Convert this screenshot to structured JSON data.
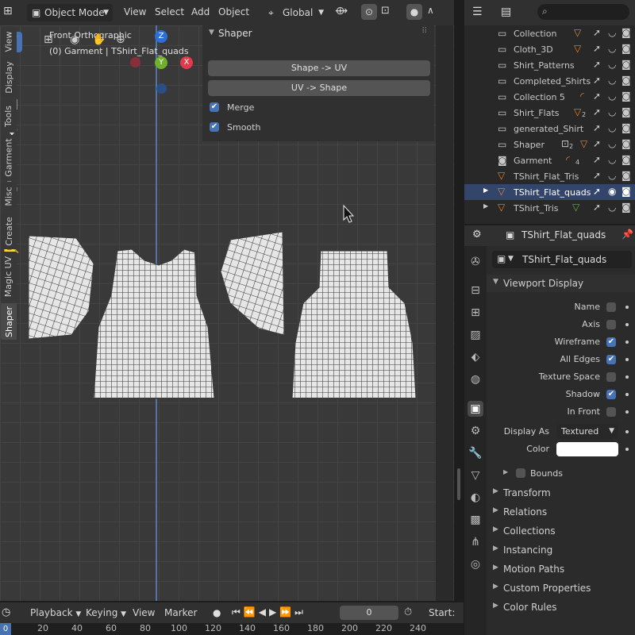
{
  "viewport_header": {
    "mode": "Object Mode",
    "menus": [
      "View",
      "Select",
      "Add",
      "Object"
    ],
    "orientation": "Global"
  },
  "viewport": {
    "view_name": "Front Orthographic",
    "object_info": "(0) Garment | TShirt_Flat_quads",
    "gizmo": {
      "z": "Z",
      "y": "Y",
      "x": "X"
    }
  },
  "npanel": {
    "title": "Shaper",
    "buttons": [
      "Shape -> UV",
      "UV -> Shape"
    ],
    "checks": [
      {
        "label": "Merge",
        "checked": true
      },
      {
        "label": "Smooth",
        "checked": true
      }
    ],
    "tabs": [
      "View",
      "Display",
      "Tools",
      "Garment",
      "Misc",
      "Create",
      "Magic UV",
      "Shaper"
    ],
    "active_tab": "Shaper"
  },
  "outliner": {
    "items": [
      {
        "name": "Collection",
        "badge": ""
      },
      {
        "name": "Cloth_3D",
        "badge": ""
      },
      {
        "name": "Shirt_Patterns",
        "badge": ""
      },
      {
        "name": "Completed_Shirts",
        "badge": ""
      },
      {
        "name": "Collection 5",
        "badge": ""
      },
      {
        "name": "Shirt_Flats",
        "badge": "2"
      },
      {
        "name": "generated_Shirt",
        "badge": ""
      },
      {
        "name": "Shaper",
        "badge": "2"
      },
      {
        "name": "Garment",
        "badge": "4"
      },
      {
        "name": "TShirt_Flat_Tris",
        "badge": ""
      },
      {
        "name": "TShirt_Flat_quads",
        "badge": ""
      },
      {
        "name": "TShirt_Tris",
        "badge": ""
      }
    ],
    "selected": "TShirt_Flat_quads"
  },
  "properties": {
    "object_name": "TShirt_Flat_quads",
    "datablock_name": "TShirt_Flat_quads",
    "panel_title": "Viewport Display",
    "options": [
      {
        "label": "Name",
        "checked": false
      },
      {
        "label": "Axis",
        "checked": false
      },
      {
        "label": "Wireframe",
        "checked": true
      },
      {
        "label": "All Edges",
        "checked": true
      },
      {
        "label": "Texture Space",
        "checked": false
      },
      {
        "label": "Shadow",
        "checked": true
      },
      {
        "label": "In Front",
        "checked": false
      }
    ],
    "display_as_label": "Display As",
    "display_as_value": "Textured",
    "color_label": "Color",
    "color_value": "#ffffff",
    "bounds_label": "Bounds",
    "sections": [
      "Transform",
      "Relations",
      "Collections",
      "Instancing",
      "Motion Paths",
      "Custom Properties",
      "Color Rules"
    ]
  },
  "timeline": {
    "menus": [
      "Playback",
      "Keying",
      "View",
      "Marker"
    ],
    "current_frame": "0",
    "start_label": "Start:",
    "ticks": [
      "20",
      "40",
      "60",
      "80",
      "100",
      "120",
      "140",
      "160",
      "180",
      "200",
      "220",
      "240"
    ],
    "playhead": "0"
  },
  "colors": {
    "accent": "#4772b3",
    "grid": "#393939",
    "outliner_select": "#33456a"
  }
}
